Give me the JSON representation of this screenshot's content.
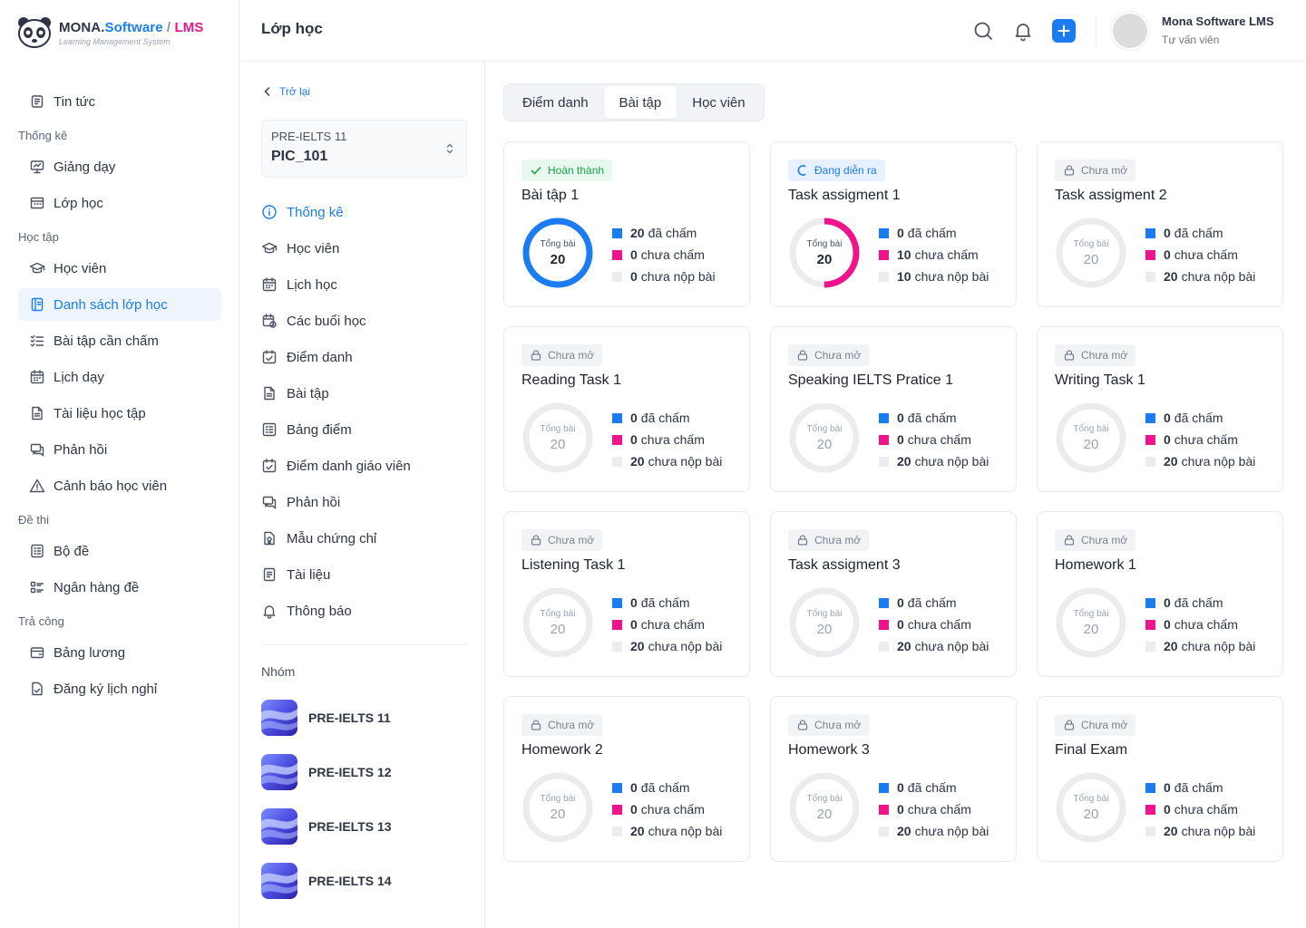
{
  "brand": {
    "name_part1": "MONA.",
    "name_part2": "Software",
    "name_part3": " / ",
    "name_part4": "LMS",
    "subtitle": "Learning Management System"
  },
  "sidebar": {
    "items": [
      {
        "type": "item",
        "label": "Tin tức",
        "icon": "news-icon",
        "active": false
      },
      {
        "type": "group",
        "label": "Thống kê"
      },
      {
        "type": "item",
        "label": "Giảng dạy",
        "icon": "presentation-icon",
        "active": false
      },
      {
        "type": "item",
        "label": "Lớp học",
        "icon": "classroom-icon",
        "active": false
      },
      {
        "type": "group",
        "label": "Học tập"
      },
      {
        "type": "item",
        "label": "Học viên",
        "icon": "graduation-cap-icon",
        "active": false
      },
      {
        "type": "item",
        "label": "Danh sách lớp học",
        "icon": "class-list-icon",
        "active": true
      },
      {
        "type": "item",
        "label": "Bài tập cần chấm",
        "icon": "checklist-icon",
        "active": false
      },
      {
        "type": "item",
        "label": "Lịch dạy",
        "icon": "calendar-icon",
        "active": false
      },
      {
        "type": "item",
        "label": "Tài liệu học tập",
        "icon": "document-icon",
        "active": false
      },
      {
        "type": "item",
        "label": "Phản hồi",
        "icon": "chat-icon",
        "active": false
      },
      {
        "type": "item",
        "label": "Cảnh báo học viên",
        "icon": "warning-icon",
        "active": false
      },
      {
        "type": "group",
        "label": "Đề thi"
      },
      {
        "type": "item",
        "label": "Bộ đề",
        "icon": "exam-set-icon",
        "active": false
      },
      {
        "type": "item",
        "label": "Ngân hàng đề",
        "icon": "question-bank-icon",
        "active": false
      },
      {
        "type": "group",
        "label": "Trả công"
      },
      {
        "type": "item",
        "label": "Bảng lương",
        "icon": "wallet-icon",
        "active": false
      },
      {
        "type": "item",
        "label": "Đăng ký lịch nghỉ",
        "icon": "leave-request-icon",
        "active": false
      }
    ]
  },
  "header": {
    "title": "Lớp học",
    "user_name": "Mona Software LMS",
    "user_role": "Tư vấn viên"
  },
  "midpanel": {
    "back_label": "Trở lại",
    "class_label": "PRE-IELTS 11",
    "class_value": "PIC_101",
    "nav": [
      {
        "label": "Thống kê",
        "icon": "info-icon",
        "active": true
      },
      {
        "label": "Học viên",
        "icon": "graduation-cap-icon",
        "active": false
      },
      {
        "label": "Lịch học",
        "icon": "calendar-icon",
        "active": false
      },
      {
        "label": "Các buổi học",
        "icon": "sessions-icon",
        "active": false
      },
      {
        "label": "Điểm danh",
        "icon": "attendance-icon",
        "active": false
      },
      {
        "label": "Bài tập",
        "icon": "document-icon",
        "active": false
      },
      {
        "label": "Bảng điểm",
        "icon": "scoreboard-icon",
        "active": false
      },
      {
        "label": "Điểm danh giáo viên",
        "icon": "attendance-icon",
        "active": false
      },
      {
        "label": "Phản hồi",
        "icon": "chat-icon",
        "active": false
      },
      {
        "label": "Mẫu chứng chỉ",
        "icon": "certificate-icon",
        "active": false
      },
      {
        "label": "Tài liệu",
        "icon": "file-icon",
        "active": false
      },
      {
        "label": "Thông báo",
        "icon": "bell-icon",
        "active": false
      }
    ],
    "group_title": "Nhóm",
    "groups": [
      "PRE-IELTS 11",
      "PRE-IELTS 12",
      "PRE-IELTS 13",
      "PRE-IELTS 14"
    ]
  },
  "tabs": [
    {
      "label": "Điểm danh",
      "active": false
    },
    {
      "label": "Bài tập",
      "active": true
    },
    {
      "label": "Học viên",
      "active": false
    }
  ],
  "legend_labels": {
    "graded": "đã chấm",
    "ungraded": "chưa chấm",
    "not_submitted": "chưa nộp bài"
  },
  "donut_caption": "Tổng bài",
  "colors": {
    "accent": "#1a7cf0",
    "graded": "#1a7cf0",
    "ungraded": "#f0148c",
    "not_submitted": "#ececef",
    "done": "#17a34a"
  },
  "assignments": [
    {
      "status": "done",
      "status_label": "Hoàn thành",
      "title": "Bài tập 1",
      "total": 20,
      "graded": 20,
      "ungraded": 0,
      "not_submitted": 0
    },
    {
      "status": "progress",
      "status_label": "Đang diễn ra",
      "title": "Task assigment 1",
      "total": 20,
      "graded": 0,
      "ungraded": 10,
      "not_submitted": 10
    },
    {
      "status": "closed",
      "status_label": "Chưa mở",
      "title": "Task assigment 2",
      "total": 20,
      "graded": 0,
      "ungraded": 0,
      "not_submitted": 20
    },
    {
      "status": "closed",
      "status_label": "Chưa mở",
      "title": "Reading Task 1",
      "total": 20,
      "graded": 0,
      "ungraded": 0,
      "not_submitted": 20
    },
    {
      "status": "closed",
      "status_label": "Chưa mở",
      "title": "Speaking IELTS Pratice 1",
      "total": 20,
      "graded": 0,
      "ungraded": 0,
      "not_submitted": 20
    },
    {
      "status": "closed",
      "status_label": "Chưa mở",
      "title": "Writing Task 1",
      "total": 20,
      "graded": 0,
      "ungraded": 0,
      "not_submitted": 20
    },
    {
      "status": "closed",
      "status_label": "Chưa mở",
      "title": "Listening Task 1",
      "total": 20,
      "graded": 0,
      "ungraded": 0,
      "not_submitted": 20
    },
    {
      "status": "closed",
      "status_label": "Chưa mở",
      "title": "Task assigment 3",
      "total": 20,
      "graded": 0,
      "ungraded": 0,
      "not_submitted": 20
    },
    {
      "status": "closed",
      "status_label": "Chưa mở",
      "title": "Homework 1",
      "total": 20,
      "graded": 0,
      "ungraded": 0,
      "not_submitted": 20
    },
    {
      "status": "closed",
      "status_label": "Chưa mở",
      "title": "Homework 2",
      "total": 20,
      "graded": 0,
      "ungraded": 0,
      "not_submitted": 20
    },
    {
      "status": "closed",
      "status_label": "Chưa mở",
      "title": "Homework 3",
      "total": 20,
      "graded": 0,
      "ungraded": 0,
      "not_submitted": 20
    },
    {
      "status": "closed",
      "status_label": "Chưa mở",
      "title": "Final Exam",
      "total": 20,
      "graded": 0,
      "ungraded": 0,
      "not_submitted": 20
    }
  ]
}
